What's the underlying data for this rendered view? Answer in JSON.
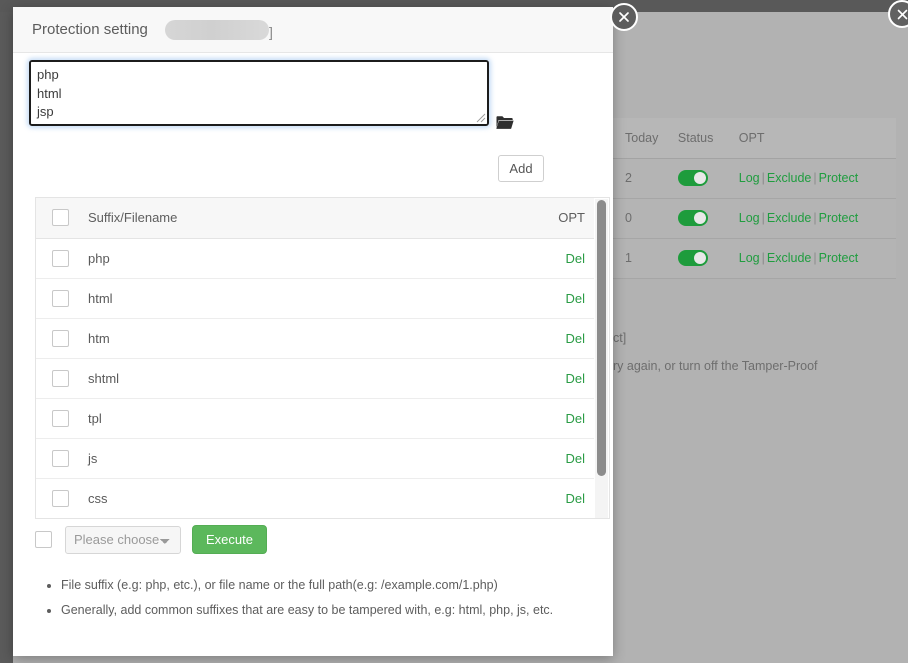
{
  "background": {
    "table": {
      "columns": [
        "Today",
        "Status",
        "OPT"
      ],
      "rows": [
        {
          "today": "2",
          "status": "on",
          "opt": [
            "Log",
            "Exclude",
            "Protect"
          ]
        },
        {
          "today": "0",
          "status": "on",
          "opt": [
            "Log",
            "Exclude",
            "Protect"
          ]
        },
        {
          "today": "1",
          "status": "on",
          "opt": [
            "Log",
            "Exclude",
            "Protect"
          ]
        }
      ],
      "separator": "|"
    },
    "notes": [
      "ct]",
      "ry again, or turn off the Tamper-Proof"
    ],
    "close_icon": "close-icon"
  },
  "modal": {
    "title": "Protection setting",
    "title_suffix": "]",
    "close_icon": "close-icon",
    "input": {
      "value": "php\nhtml\njsp",
      "placeholder": ""
    },
    "folder_icon": "folder-open-icon",
    "add_label": "Add",
    "list": {
      "columns": [
        "Suffix/Filename",
        "OPT"
      ],
      "rows": [
        {
          "name": "php",
          "action": "Del"
        },
        {
          "name": "html",
          "action": "Del"
        },
        {
          "name": "htm",
          "action": "Del"
        },
        {
          "name": "shtml",
          "action": "Del"
        },
        {
          "name": "tpl",
          "action": "Del"
        },
        {
          "name": "js",
          "action": "Del"
        },
        {
          "name": "css",
          "action": "Del"
        }
      ]
    },
    "bulk": {
      "select_value": "Please choose",
      "execute_label": "Execute"
    },
    "notes": [
      "File suffix (e.g: php, etc.), or file name or the full path(e.g: /example.com/1.php)",
      "Generally, add common suffixes that are easy to be tampered with, e.g: html, php, js, etc."
    ]
  },
  "colors": {
    "accent_green": "#5cb85c",
    "link_green": "#2a9c45",
    "toggle_green": "#1e9c3c",
    "overlay_gray": "#b2b2b2"
  }
}
